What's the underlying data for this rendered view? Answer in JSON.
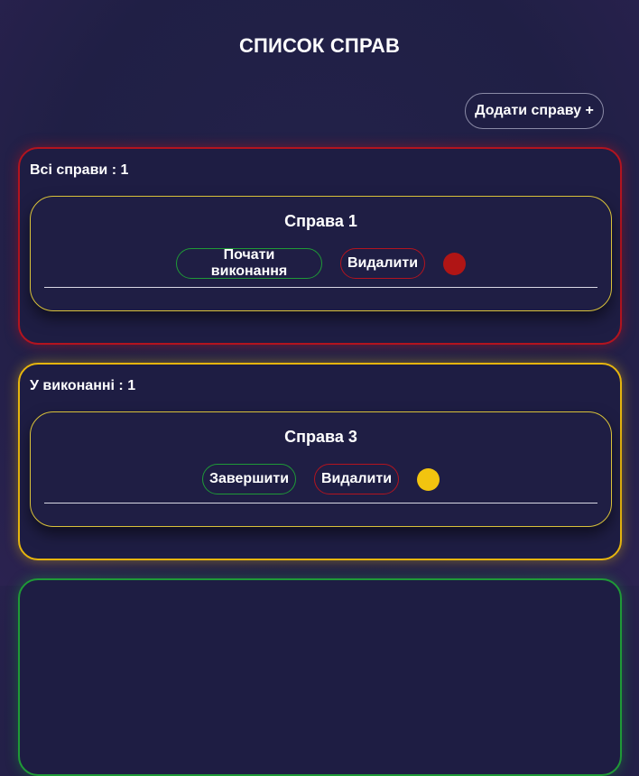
{
  "page": {
    "title": "СПИСОК СПРАВ"
  },
  "toolbar": {
    "add_label": "Додати справу +"
  },
  "colors": {
    "background": "#201f45",
    "red": "#b3141f",
    "yellow": "#e6b50e",
    "green": "#1f9a37",
    "card_border": "#d9c23a",
    "status_red": "#b01515",
    "status_yellow": "#f2c40f"
  },
  "groups": [
    {
      "label": "Всі справи : 1",
      "task": {
        "title": "Справа 1",
        "action_label": "Почати виконання",
        "delete_label": "Видалити",
        "status_color": "#b01515"
      }
    },
    {
      "label": "У виконанні : 1",
      "task": {
        "title": "Справа 3",
        "action_label": "Завершити",
        "delete_label": "Видалити",
        "status_color": "#f2c40f"
      }
    }
  ]
}
